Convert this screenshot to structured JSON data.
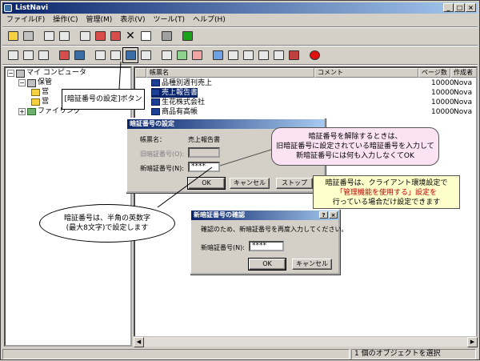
{
  "window": {
    "title": "ListNavi",
    "min": "_",
    "max": "□",
    "close": "×"
  },
  "menu": [
    "ファイル(F)",
    "操作(C)",
    "管理(M)",
    "表示(V)",
    "ツール(T)",
    "ヘルプ(H)"
  ],
  "tree": {
    "root": "マイ コンピュータ",
    "child1": "保管",
    "child1_sub1": "営",
    "child1_sub2": "営",
    "child2": "ファイリング",
    "expand_minus": "−",
    "expand_plus": "+"
  },
  "list": {
    "columns": [
      "帳票名",
      "コメント",
      "ページ数",
      "作成者"
    ],
    "rows": [
      {
        "name": "品種別週刊売上",
        "pages": "10000",
        "author": "Nova"
      },
      {
        "name": "売上報告書",
        "pages": "10000",
        "author": "Nova"
      },
      {
        "name": "生花株式会社",
        "pages": "10000",
        "author": "Nova"
      },
      {
        "name": "商品有高帳",
        "pages": "10000",
        "author": "Nova"
      }
    ]
  },
  "status": {
    "text": "1 個のオブジェクトを選択"
  },
  "callouts": {
    "button": "[暗証番号の設定]ボタン",
    "pink_line1": "暗証番号を解除するときは、",
    "pink_line2": "旧暗証番号に設定されている暗証番号を入力して",
    "pink_line3": "新暗証番号には何も入力しなくてOK",
    "yellow_line1": "暗証番号は、クライアント環境設定で",
    "yellow_line2": "「管理機能を使用する」設定を",
    "yellow_line3": "行っている場合だけ設定できます",
    "round_line1": "暗証番号は、半角の英数字",
    "round_line2": "(最大8文字)で設定します"
  },
  "dialog1": {
    "title": "暗証番号の設定",
    "form_label": "帳票名：",
    "form_value": "売上報告書",
    "old_label": "旧暗証番号(O):",
    "new_label": "新暗証番号(N):",
    "new_value": "****",
    "ok": "OK",
    "cancel": "キャンセル",
    "stop": "ストップ"
  },
  "dialog2": {
    "title": "新暗証番号の確認",
    "help": "?",
    "close": "×",
    "message": "確認のため、新暗証番号を再度入力してください。",
    "label": "新暗証番号(N):",
    "value": "****",
    "ok": "OK",
    "cancel": "キャンセル"
  }
}
